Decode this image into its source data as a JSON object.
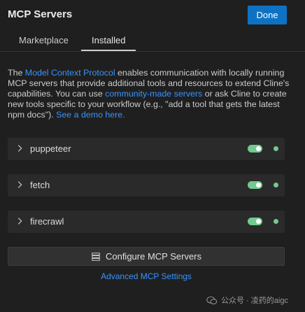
{
  "header": {
    "title": "MCP Servers",
    "done_label": "Done"
  },
  "tabs": [
    {
      "label": "Marketplace",
      "active": false
    },
    {
      "label": "Installed",
      "active": true
    }
  ],
  "description": {
    "part1": "The ",
    "link1": "Model Context Protocol",
    "part2": " enables communication with locally running MCP servers that provide additional tools and resources to extend Cline's capabilities. You can use ",
    "link2": "community-made servers",
    "part3": " or ask Cline to create new tools specific to your workflow (e.g., \"add a tool that gets the latest npm docs\"). ",
    "link3": "See a demo here."
  },
  "servers": [
    {
      "name": "puppeteer",
      "enabled": true,
      "status": "connected"
    },
    {
      "name": "fetch",
      "enabled": true,
      "status": "connected"
    },
    {
      "name": "firecrawl",
      "enabled": true,
      "status": "connected"
    }
  ],
  "configure_button_label": "Configure MCP Servers",
  "advanced_link_label": "Advanced MCP Settings",
  "watermark": {
    "text": "公众号 · 凌药的aigc",
    "icon": "wechat-icon"
  },
  "colors": {
    "background": "#1f1f1f",
    "accent": "#0e72c4",
    "link": "#3794ff",
    "toggle_on": "#73c991",
    "status_connected": "#73c991"
  }
}
